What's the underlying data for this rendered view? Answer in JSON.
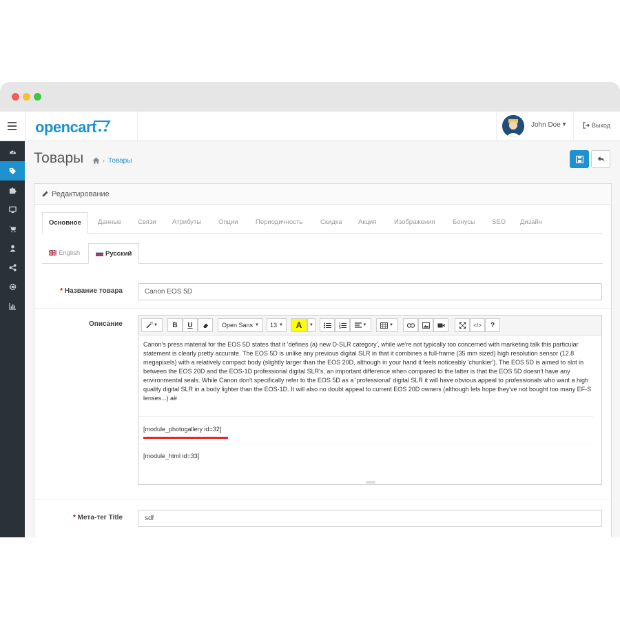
{
  "header": {
    "logo_text": "opencart",
    "user_name": "John Doe",
    "logout_label": "Выход"
  },
  "sidebar": {
    "icons": [
      "dashboard-icon",
      "tag-icon",
      "puzzle-icon",
      "desktop-icon",
      "cart-icon",
      "user-icon",
      "share-icon",
      "gear-icon",
      "chart-icon"
    ]
  },
  "page": {
    "title": "Товары",
    "breadcrumb": "Товары"
  },
  "panel": {
    "heading": "Редактирование",
    "tabs": [
      "Основное",
      "Данные",
      "Связи",
      "Атрибуты",
      "Опции",
      "Периодичность",
      "Скидка",
      "Акция",
      "Изображения",
      "Бонусы",
      "SEO",
      "Дизайн"
    ],
    "lang_tabs": [
      "English",
      "Русский"
    ]
  },
  "form": {
    "name_label": "Название товара",
    "name_value": "Canon EOS 5D",
    "description_label": "Описание",
    "meta_label": "Мета-тег Title",
    "meta_value": "sdf"
  },
  "editor": {
    "font": "Open Sans",
    "size": "13",
    "paragraph": "Canon's press material for the EOS 5D states that it 'defines (a) new D-SLR category', while we're not typically too concerned with marketing talk this particular statement is clearly pretty accurate. The EOS 5D is unlike any previous digital SLR in that it combines a full-frame (35 mm sized) high resolution sensor (12.8 megapixels) with a relatively compact body (slightly larger than the EOS 20D, although in your hand it feels noticeably 'chunkier'). The EOS 5D is aimed to slot in between the EOS 20D and the EOS-1D professional digital SLR's, an important difference when compared to the latter is that the EOS 5D doesn't have any environmental seals. While Canon don't specifically refer to the EOS 5D as a 'professional' digital SLR it will have obvious appeal to professionals who want a high quality digital SLR in a body lighter than the EOS-1D. It will also no doubt appeal to current EOS 20D owners (although lets hope they've not bought too many EF-S lenses...) aë",
    "module1": "[module_photogallery id=32]",
    "module2": "[module_html id=33]"
  },
  "colors": {
    "brand": "#1e91cf",
    "sidebar": "#2a3138",
    "underline": "#e52329"
  }
}
